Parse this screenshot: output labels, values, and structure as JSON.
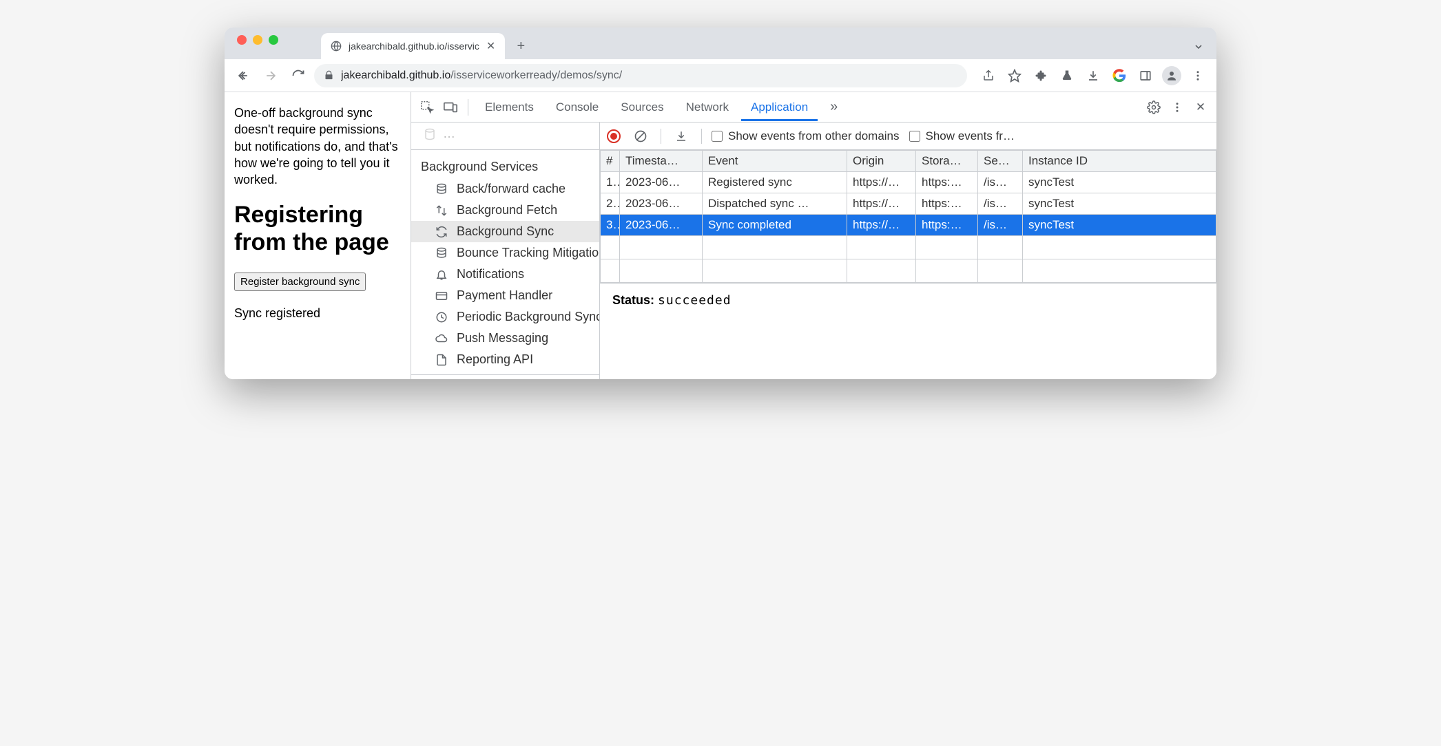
{
  "tab": {
    "title": "jakearchibald.github.io/isservic"
  },
  "url": {
    "host": "jakearchibald.github.io",
    "path": "/isserviceworkerready/demos/sync/"
  },
  "page": {
    "paragraph": "One-off background sync doesn't require permissions, but notifications do, and that's how we're going to tell you it worked.",
    "heading": "Registering from the page",
    "button": "Register background sync",
    "status": "Sync registered"
  },
  "devtools": {
    "tabs": [
      "Elements",
      "Console",
      "Sources",
      "Network",
      "Application"
    ],
    "active_tab": "Application",
    "more": "»"
  },
  "sidebar": {
    "section": "Background Services",
    "items": [
      {
        "label": "Back/forward cache",
        "icon": "database"
      },
      {
        "label": "Background Fetch",
        "icon": "updown"
      },
      {
        "label": "Background Sync",
        "icon": "sync",
        "selected": true
      },
      {
        "label": "Bounce Tracking Mitigations",
        "icon": "database"
      },
      {
        "label": "Notifications",
        "icon": "bell"
      },
      {
        "label": "Payment Handler",
        "icon": "card"
      },
      {
        "label": "Periodic Background Sync",
        "icon": "clock"
      },
      {
        "label": "Push Messaging",
        "icon": "cloud"
      },
      {
        "label": "Reporting API",
        "icon": "file"
      }
    ]
  },
  "events": {
    "toolbar": {
      "show_other": "Show events from other domains",
      "show_fr": "Show events fr…"
    },
    "columns": [
      "#",
      "Timesta…",
      "Event",
      "Origin",
      "Stora…",
      "Se…",
      "Instance ID"
    ],
    "rows": [
      {
        "n": "1.",
        "ts": "2023-06…",
        "event": "Registered sync",
        "origin": "https://…",
        "storage": "https:…",
        "scope": "/is…",
        "instance": "syncTest"
      },
      {
        "n": "2.",
        "ts": "2023-06…",
        "event": "Dispatched sync …",
        "origin": "https://…",
        "storage": "https:…",
        "scope": "/is…",
        "instance": "syncTest"
      },
      {
        "n": "3.",
        "ts": "2023-06…",
        "event": "Sync completed",
        "origin": "https://…",
        "storage": "https:…",
        "scope": "/is…",
        "instance": "syncTest",
        "selected": true
      }
    ],
    "status_label": "Status:",
    "status_value": "succeeded"
  }
}
